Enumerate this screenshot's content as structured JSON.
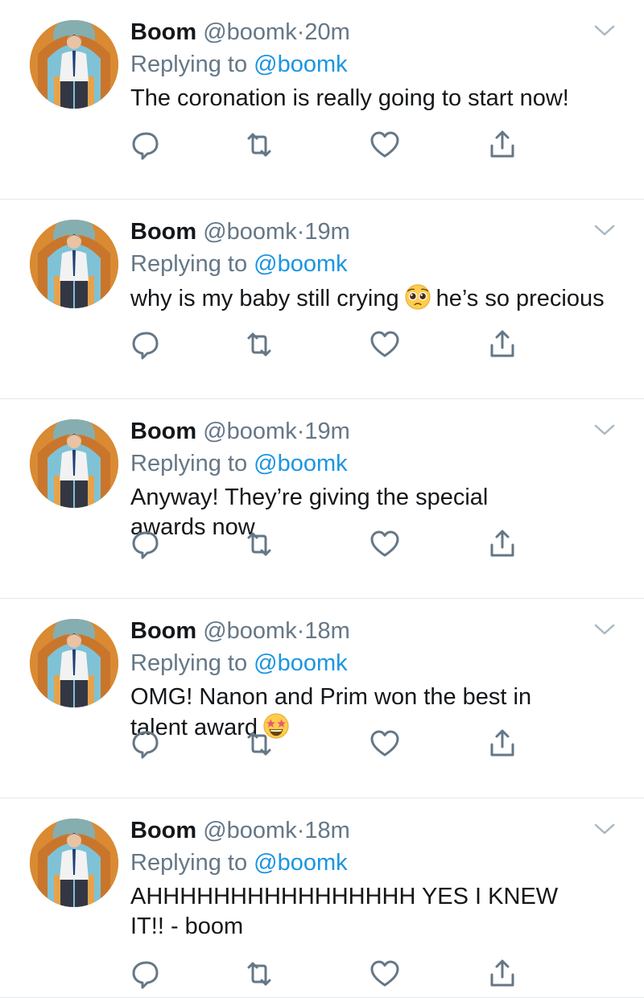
{
  "tweets": [
    {
      "name": "Boom",
      "handle": "@boomk",
      "separator": "·",
      "time": "20m",
      "replying_prefix": "Replying to",
      "replying_handle": "@boomk",
      "text": "The coronation is really going to start now!"
    },
    {
      "name": "Boom",
      "handle": "@boomk",
      "separator": "·",
      "time": "19m",
      "replying_prefix": "Replying to",
      "replying_handle": "@boomk",
      "text_before_emoji": "why is my baby still crying",
      "emoji": "pleading-face",
      "text_after_emoji": "he’s so precious"
    },
    {
      "name": "Boom",
      "handle": "@boomk",
      "separator": "·",
      "time": "19m",
      "replying_prefix": "Replying to",
      "replying_handle": "@boomk",
      "text": "Anyway! They’re giving the special awards now"
    },
    {
      "name": "Boom",
      "handle": "@boomk",
      "separator": "·",
      "time": "18m",
      "replying_prefix": "Replying to",
      "replying_handle": "@boomk",
      "text_before_emoji": "OMG! Nanon and Prim won the best in talent award",
      "emoji": "star-struck-face"
    },
    {
      "name": "Boom",
      "handle": "@boomk",
      "separator": "·",
      "time": "18m",
      "replying_prefix": "Replying to",
      "replying_handle": "@boomk",
      "text": "AHHHHHHHHHHHHHHHH YES I KNEW IT!! - boom"
    }
  ],
  "icons": {
    "reply": "reply-icon",
    "retweet": "retweet-icon",
    "like": "like-icon",
    "share": "share-icon",
    "more": "chevron-down-icon"
  },
  "colors": {
    "link": "#1b95e0",
    "secondary_text": "#657786",
    "icon": "#657786",
    "divider": "#e1e8ed"
  }
}
